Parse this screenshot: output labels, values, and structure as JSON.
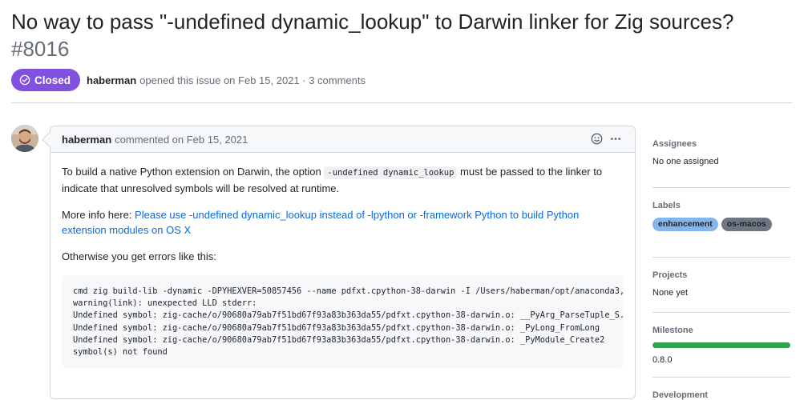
{
  "issue": {
    "title": "No way to pass \"-undefined dynamic_lookup\" to Darwin linker for Zig sources?",
    "number": "#8016",
    "state": "Closed",
    "author": "haberman",
    "opened_text": "opened this issue on Feb 15, 2021 · 3 comments"
  },
  "comment": {
    "author": "haberman",
    "date_text": "commented on Feb 15, 2021",
    "p1_before": "To build a native Python extension on Darwin, the option ",
    "p1_code": "-undefined dynamic_lookup",
    "p1_after": " must be passed to the linker to indicate that unresolved symbols will be resolved at runtime.",
    "p2_prefix": "More info here: ",
    "p2_link": "Please use -undefined dynamic_lookup instead of -lpython or -framework Python to build Python extension modules on OS X",
    "p3": "Otherwise you get errors like this:",
    "code_lines": [
      "cmd zig build-lib -dynamic -DPYHEXVER=50857456 --name pdfxt.cpython-38-darwin -I /Users/haberman/opt/anaconda3,",
      "warning(link): unexpected LLD stderr:",
      "Undefined symbol: zig-cache/o/90680a79ab7f51bd67f93a83b363da55/pdfxt.cpython-38-darwin.o: __PyArg_ParseTuple_S.",
      "Undefined symbol: zig-cache/o/90680a79ab7f51bd67f93a83b363da55/pdfxt.cpython-38-darwin.o: _PyLong_FromLong",
      "Undefined symbol: zig-cache/o/90680a79ab7f51bd67f93a83b363da55/pdfxt.cpython-38-darwin.o: _PyModule_Create2",
      "symbol(s) not found"
    ]
  },
  "sidebar": {
    "assignees_title": "Assignees",
    "assignees_value": "No one assigned",
    "labels_title": "Labels",
    "labels": [
      {
        "name": "enhancement",
        "bg": "#84b6eb",
        "fg": "#1f2328"
      },
      {
        "name": "os-macos",
        "bg": "#6e7681",
        "fg": "#1f2328"
      }
    ],
    "projects_title": "Projects",
    "projects_value": "None yet",
    "milestone_title": "Milestone",
    "milestone_progress": 1.0,
    "milestone_value": "0.8.0",
    "development_title": "Development"
  },
  "colors": {
    "closed_purple": "#8250df",
    "link_blue": "#0969da",
    "progress_green": "#2da44e"
  }
}
